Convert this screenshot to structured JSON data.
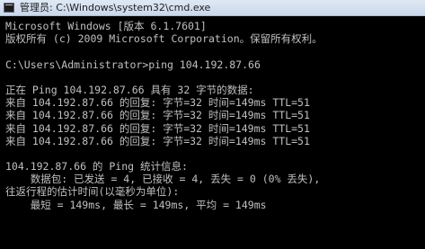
{
  "window": {
    "title": "管理员: C:\\Windows\\system32\\cmd.exe",
    "icon": "cmd-icon"
  },
  "console": {
    "colors": {
      "background": "#000000",
      "text": "#c0c0c0"
    },
    "lines": [
      "Microsoft Windows [版本 6.1.7601]",
      "版权所有 (c) 2009 Microsoft Corporation。保留所有权利。",
      "",
      "C:\\Users\\Administrator>ping 104.192.87.66",
      "",
      "正在 Ping 104.192.87.66 具有 32 字节的数据:",
      "来自 104.192.87.66 的回复: 字节=32 时间=149ms TTL=51",
      "来自 104.192.87.66 的回复: 字节=32 时间=149ms TTL=51",
      "来自 104.192.87.66 的回复: 字节=32 时间=149ms TTL=51",
      "来自 104.192.87.66 的回复: 字节=32 时间=149ms TTL=51",
      "",
      "104.192.87.66 的 Ping 统计信息:",
      "    数据包: 已发送 = 4, 已接收 = 4, 丢失 = 0 (0% 丢失),",
      "往返行程的估计时间(以毫秒为单位):",
      "    最短 = 149ms, 最长 = 149ms, 平均 = 149ms"
    ]
  }
}
